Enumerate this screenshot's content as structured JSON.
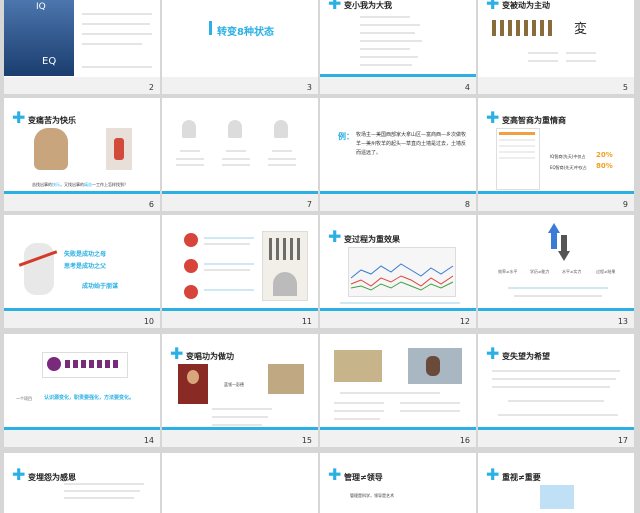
{
  "slides": [
    {
      "num": "2",
      "title": "",
      "caption": "",
      "iq": "IQ",
      "eq": "EQ"
    },
    {
      "num": "3",
      "title": "转变8种状态"
    },
    {
      "num": "4",
      "title": "变小我为大我"
    },
    {
      "num": "5",
      "title": "变被动为主动"
    },
    {
      "num": "6",
      "title": "变痛苦为快乐",
      "caption_a": "苦找出事的",
      "caption_b": "快乐",
      "caption_c": "，又找出事的",
      "caption_d": "痛苦",
      "caption_e": "—工作上怎样找到？"
    },
    {
      "num": "7"
    },
    {
      "num": "8",
      "title": "例：",
      "body": "牧场主—美国西部家大拿山区—富商西—乡次做牧羊—美州牧羊的起头—草直向土墙是过去，土墙反而遥远了。"
    },
    {
      "num": "9",
      "title": "变高智商为重情商",
      "iq_label": "IQ智商(先天)中仅占",
      "iq_value": "20%",
      "eq_label": "EQ智商(先天)中仅占",
      "eq_value": "80%"
    },
    {
      "num": "10",
      "line1": "失败是成功之母",
      "line2": "思考是成功之父",
      "line3": "成功始于朋谋"
    },
    {
      "num": "11"
    },
    {
      "num": "12",
      "title": "变过程为重效果"
    },
    {
      "num": "13",
      "l1": "效率≠水平",
      "l2": "学历≠能力",
      "l3": "水平≠实力",
      "l4": "过程≠结果"
    },
    {
      "num": "14",
      "tag": "认识源变化，职责要强化，方法要变化。",
      "prefix": "一个项目"
    },
    {
      "num": "15",
      "title": "变唱功为做功",
      "name": "蓝领—彭德"
    },
    {
      "num": "16"
    },
    {
      "num": "17",
      "title": "变失望为希望"
    },
    {
      "num": "",
      "title": "变埋怨为感恩"
    },
    {
      "num": "",
      "title": ""
    },
    {
      "num": "",
      "title": "管理≠领导",
      "body": "管理是科学，领导是艺术"
    },
    {
      "num": "",
      "title": "重视≠重要"
    }
  ]
}
